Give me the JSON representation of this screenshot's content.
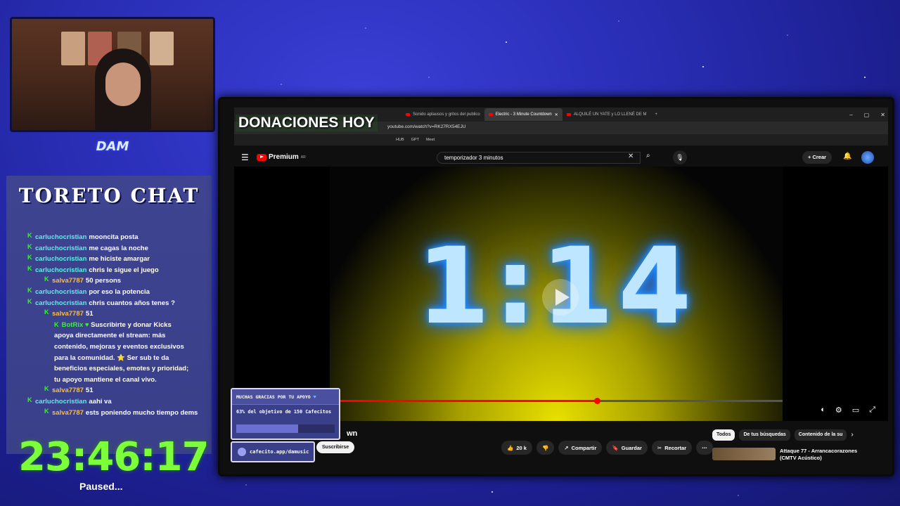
{
  "overlay": {
    "donaciones_banner": "DONACIONES HOY",
    "logo": "DAM",
    "chat_title": "TORETO CHAT",
    "clock": "23:46:17",
    "status": "Paused..."
  },
  "chat": {
    "messages": [
      {
        "user": "carluchocristian",
        "text": "mooncita posta",
        "indent": 0
      },
      {
        "user": "carluchocristian",
        "text": "me cagas la noche",
        "indent": 0
      },
      {
        "user": "carluchocristian",
        "text": "me hiciste amargar",
        "indent": 0
      },
      {
        "user": "carluchocristian",
        "text": "chris le sigue el juego",
        "indent": 0
      },
      {
        "user": "salva7787",
        "text": "50 persons",
        "indent": 1
      },
      {
        "user": "carluchocristian",
        "text": "por eso la potencia",
        "indent": 0
      },
      {
        "user": "carluchocristian",
        "text": "chris cuantos años tenes ?",
        "indent": 0
      },
      {
        "user": "salva7787",
        "text": "51",
        "indent": 1
      }
    ],
    "botrix": {
      "user": "BotRix",
      "text": "Suscribirte y donar Kicks apoya directamente el stream: más contenido, mejoras y eventos exclusivos para la comunidad. ⭐ Ser sub te da beneficios especiales, emotes y prioridad; tu apoyo mantiene el canal vivo."
    },
    "messages_after": [
      {
        "user": "salva7787",
        "text": "51",
        "indent": 1
      },
      {
        "user": "carluchocristian",
        "text": "aahi va",
        "indent": 0
      },
      {
        "user": "salva7787",
        "text": "ests poniendo mucho tiempo dems",
        "indent": 1
      }
    ]
  },
  "browser": {
    "tabs": [
      {
        "label": "Sonido aplausos y gritos del publico",
        "active": false
      },
      {
        "label": "Electric - 3 Minute Countdown",
        "active": true
      },
      {
        "label": "ALQUILÉ UN YATE y LO LLENÉ DE M",
        "active": false
      }
    ],
    "url": "youtube.com/watch?v=RK27RX54EJU",
    "bookmarks": [
      "HUB",
      "GPT",
      "Meet"
    ]
  },
  "youtube": {
    "logo_text": "Premium",
    "logo_region": "AR",
    "search_value": "temporizador 3 minutos",
    "crear_label": "Crear",
    "countdown": "1:14",
    "progress": 0.59,
    "title_fragment": "wn",
    "likes": "20 k",
    "share_label": "Compartir",
    "save_label": "Guardar",
    "clip_label": "Recortar",
    "chips": [
      "Todos",
      "De tus búsquedas",
      "Contenido de la su"
    ],
    "rec_title": "Attaque 77 - Arrancacorazones (CMTV Acústico)"
  },
  "donation": {
    "header": "MUCHAS GRACIAS POR TU APOYO",
    "goal_text": "63% del objetivo de 150 Cafecitos",
    "progress": 0.63,
    "link": "cafecito.app/damusic",
    "subscribe_label": "Suscribirse"
  }
}
